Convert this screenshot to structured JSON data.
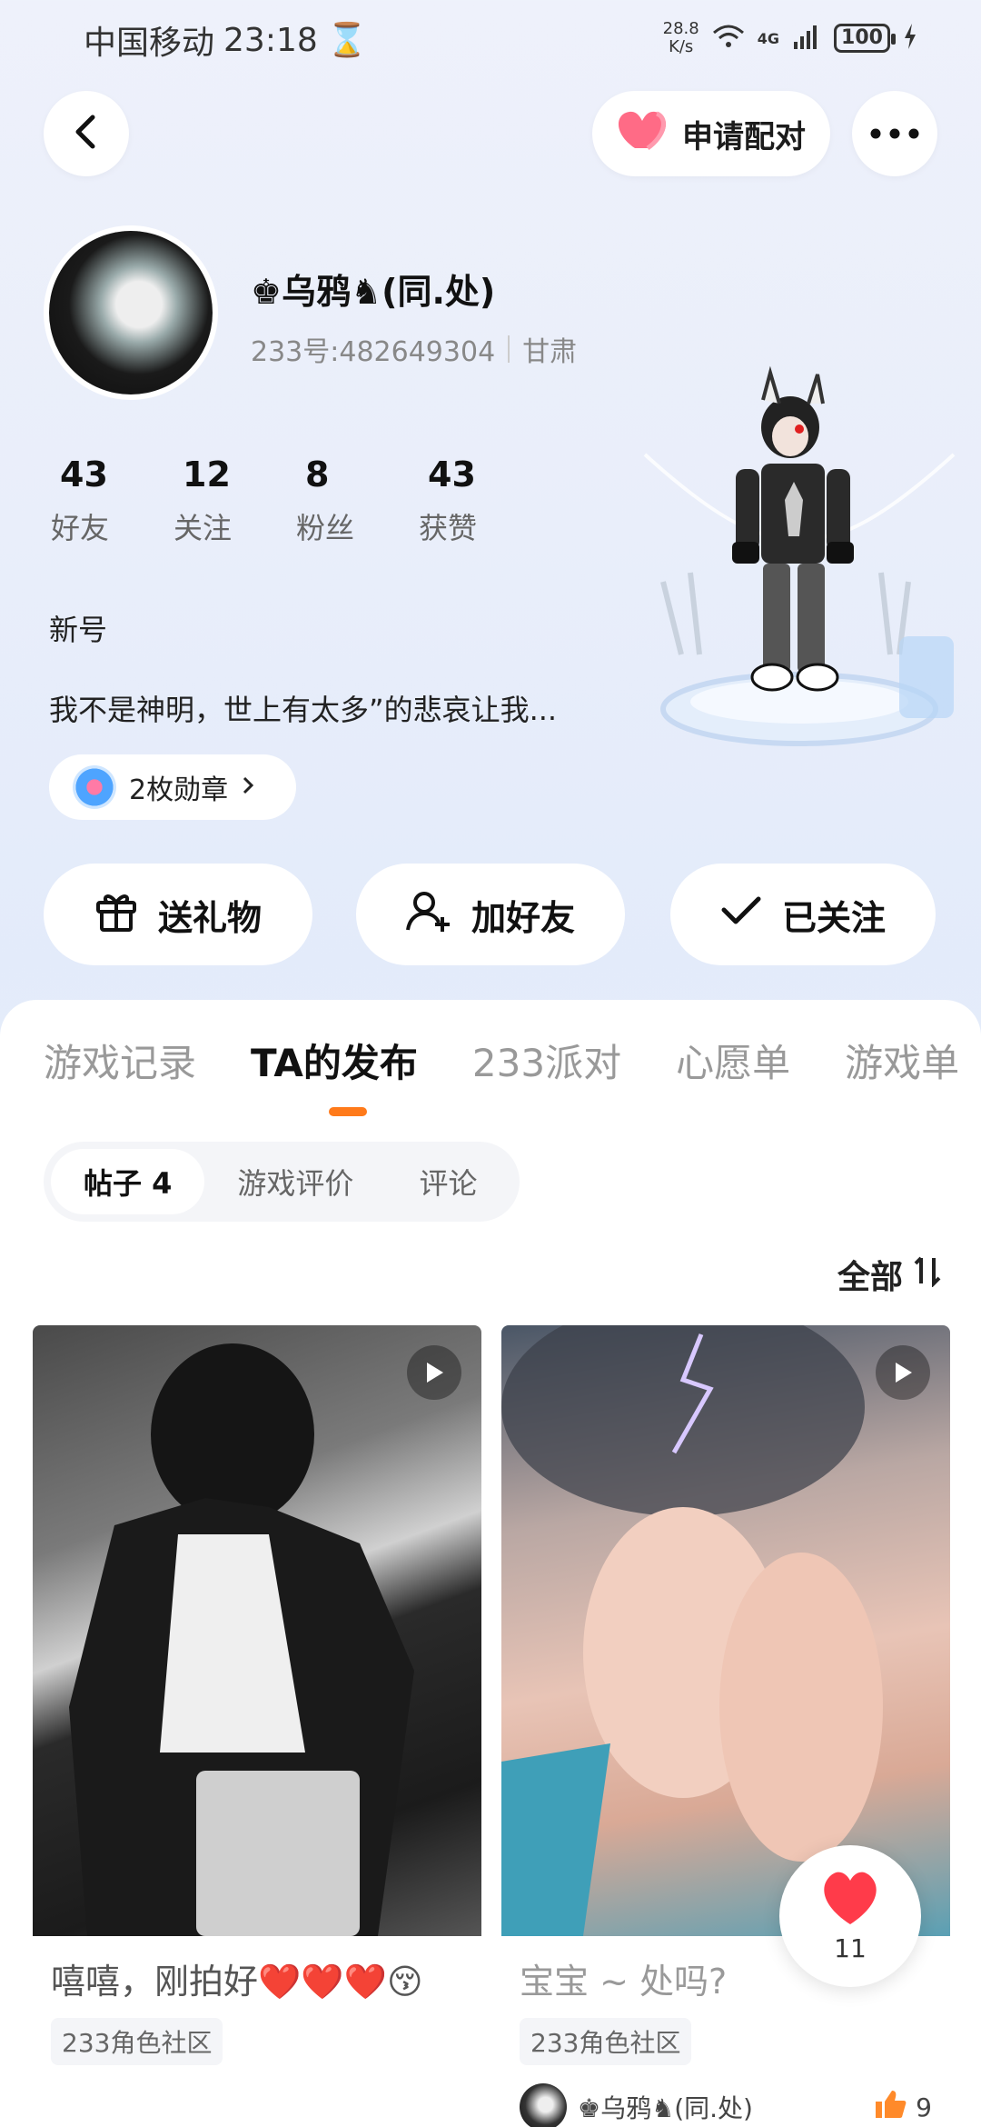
{
  "status": {
    "carrier": "中国移动",
    "time": "23:18",
    "speed_value": "28.8",
    "speed_unit": "K/s",
    "network": "4G",
    "battery": "100"
  },
  "header": {
    "match_label": "申请配对"
  },
  "profile": {
    "name": "♚乌鸦♞(同.处)",
    "id_text": "233号:482649304",
    "region": "甘肃",
    "stats": [
      {
        "num": "43",
        "label": "好友"
      },
      {
        "num": "12",
        "label": "关注"
      },
      {
        "num": "8",
        "label": "粉丝"
      },
      {
        "num": "43",
        "label": "获赞"
      }
    ],
    "tagline": "新号",
    "bio": "我不是神明，世上有太多”的悲哀让我...",
    "medal": "2枚勋章"
  },
  "actions": {
    "gift": "送礼物",
    "add_friend": "加好友",
    "followed": "已关注"
  },
  "tabs": [
    "游戏记录",
    "TA的发布",
    "233派对",
    "心愿单",
    "游戏单"
  ],
  "subtabs": [
    "帖子 4",
    "游戏评价",
    "评论"
  ],
  "sort_label": "全部",
  "cards": [
    {
      "title": "嘻嘻，刚拍好❤️❤️❤️😚",
      "tag": "233角色社区"
    },
    {
      "title": "宝宝 ~ 处吗?",
      "tag": "233角色社区",
      "author": "♚乌鸦♞(同.处)",
      "likes": "9"
    }
  ],
  "like_fab": {
    "count": "11"
  }
}
